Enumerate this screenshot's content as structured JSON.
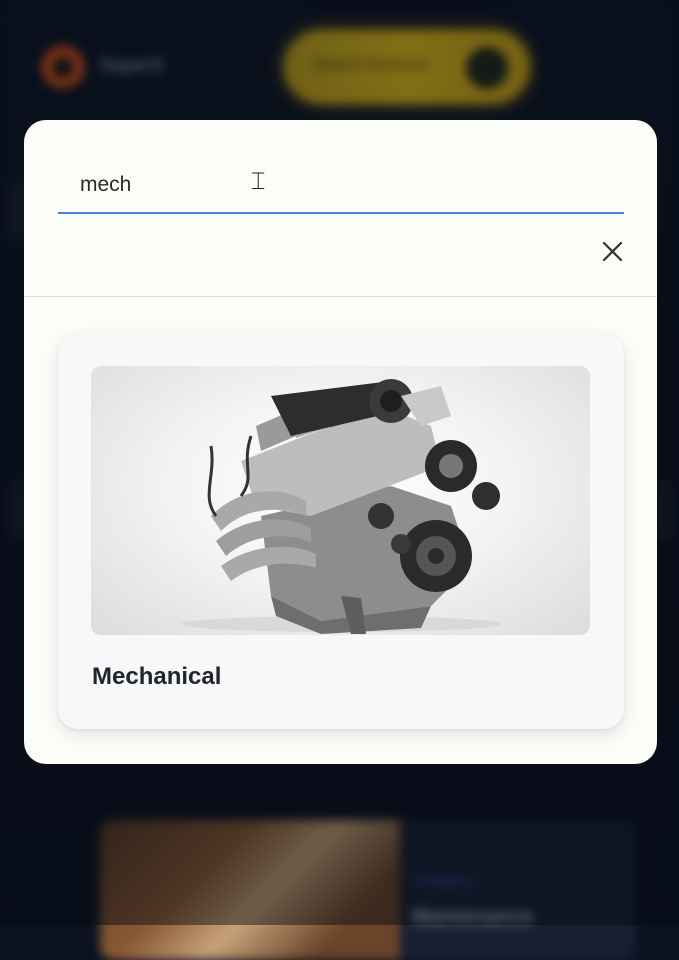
{
  "background_page": {
    "brand_name": "SuperS",
    "search_pill_label": "Search Services",
    "card_tag": "Category",
    "card_title": "Maintenance"
  },
  "search_modal": {
    "input_value": "mech",
    "results": [
      {
        "title": "Mechanical",
        "image_subject": "car engine (V8 block)"
      }
    ]
  },
  "icons": {
    "close": "close-icon",
    "cursor": "text-cursor-icon",
    "logo": "flame-logo-icon"
  },
  "colors": {
    "accent_underline": "#4a7fd4",
    "search_pill": "#e7c21c",
    "modal_bg": "#fcfcf8",
    "card_bg": "#f7f8fa"
  }
}
